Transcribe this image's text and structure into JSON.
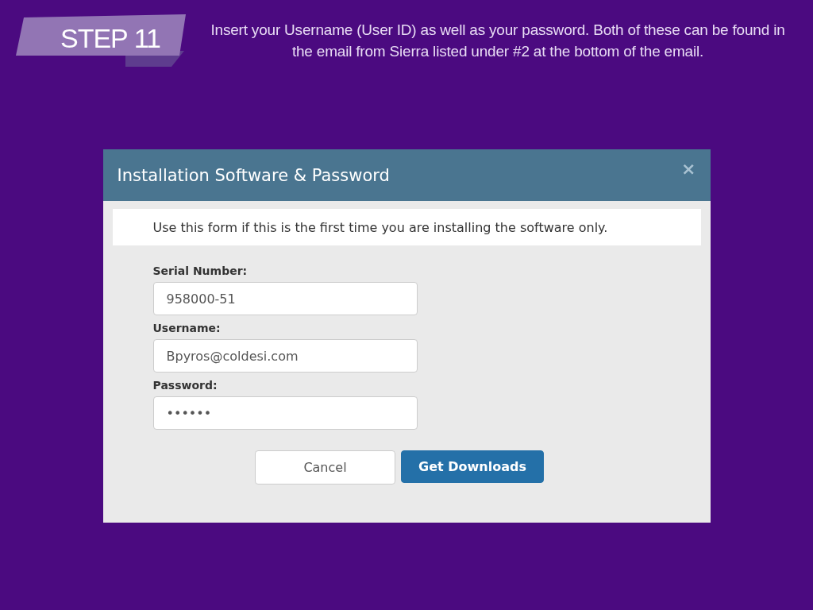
{
  "slide": {
    "step_label": "STEP 11",
    "caption": "Insert your Username (User ID) as well as your password. Both of these can be found in the email from Sierra listed under #2 at the bottom of the email."
  },
  "dialog": {
    "title": "Installation Software & Password",
    "close": "×",
    "notice": "Use this form if this is the first time you are installing the software only.",
    "fields": [
      {
        "label": "Serial Number:",
        "value": "958000-51"
      },
      {
        "label": "Username:",
        "value": "Bpyros@coldesi.com"
      },
      {
        "label": "Password:",
        "value": "••••••"
      }
    ],
    "buttons": [
      {
        "label": "Cancel",
        "kind": "secondary"
      },
      {
        "label": "Get Downloads",
        "kind": "primary"
      }
    ]
  }
}
